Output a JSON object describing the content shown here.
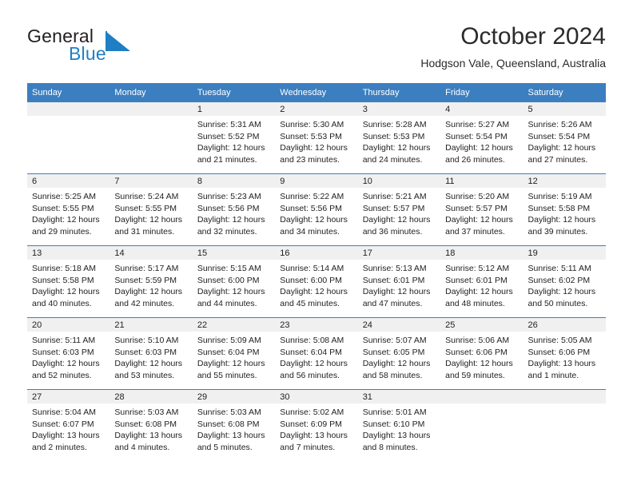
{
  "logo": {
    "word_one": "General",
    "word_two": "Blue",
    "flag_color": "#1f7fc4",
    "text_color": "#231f20"
  },
  "header": {
    "title": "October 2024",
    "subtitle": "Hodgson Vale, Queensland, Australia"
  },
  "theme": {
    "header_blue": "#3c7fc0",
    "day_band_gray": "#f0f0f0",
    "text": "#222222"
  },
  "weekday_headers": [
    "Sunday",
    "Monday",
    "Tuesday",
    "Wednesday",
    "Thursday",
    "Friday",
    "Saturday"
  ],
  "weeks": [
    [
      {
        "day": ""
      },
      {
        "day": ""
      },
      {
        "day": "1",
        "sunrise": "Sunrise: 5:31 AM",
        "sunset": "Sunset: 5:52 PM",
        "daylight_l1": "Daylight: 12 hours",
        "daylight_l2": "and 21 minutes."
      },
      {
        "day": "2",
        "sunrise": "Sunrise: 5:30 AM",
        "sunset": "Sunset: 5:53 PM",
        "daylight_l1": "Daylight: 12 hours",
        "daylight_l2": "and 23 minutes."
      },
      {
        "day": "3",
        "sunrise": "Sunrise: 5:28 AM",
        "sunset": "Sunset: 5:53 PM",
        "daylight_l1": "Daylight: 12 hours",
        "daylight_l2": "and 24 minutes."
      },
      {
        "day": "4",
        "sunrise": "Sunrise: 5:27 AM",
        "sunset": "Sunset: 5:54 PM",
        "daylight_l1": "Daylight: 12 hours",
        "daylight_l2": "and 26 minutes."
      },
      {
        "day": "5",
        "sunrise": "Sunrise: 5:26 AM",
        "sunset": "Sunset: 5:54 PM",
        "daylight_l1": "Daylight: 12 hours",
        "daylight_l2": "and 27 minutes."
      }
    ],
    [
      {
        "day": "6",
        "sunrise": "Sunrise: 5:25 AM",
        "sunset": "Sunset: 5:55 PM",
        "daylight_l1": "Daylight: 12 hours",
        "daylight_l2": "and 29 minutes."
      },
      {
        "day": "7",
        "sunrise": "Sunrise: 5:24 AM",
        "sunset": "Sunset: 5:55 PM",
        "daylight_l1": "Daylight: 12 hours",
        "daylight_l2": "and 31 minutes."
      },
      {
        "day": "8",
        "sunrise": "Sunrise: 5:23 AM",
        "sunset": "Sunset: 5:56 PM",
        "daylight_l1": "Daylight: 12 hours",
        "daylight_l2": "and 32 minutes."
      },
      {
        "day": "9",
        "sunrise": "Sunrise: 5:22 AM",
        "sunset": "Sunset: 5:56 PM",
        "daylight_l1": "Daylight: 12 hours",
        "daylight_l2": "and 34 minutes."
      },
      {
        "day": "10",
        "sunrise": "Sunrise: 5:21 AM",
        "sunset": "Sunset: 5:57 PM",
        "daylight_l1": "Daylight: 12 hours",
        "daylight_l2": "and 36 minutes."
      },
      {
        "day": "11",
        "sunrise": "Sunrise: 5:20 AM",
        "sunset": "Sunset: 5:57 PM",
        "daylight_l1": "Daylight: 12 hours",
        "daylight_l2": "and 37 minutes."
      },
      {
        "day": "12",
        "sunrise": "Sunrise: 5:19 AM",
        "sunset": "Sunset: 5:58 PM",
        "daylight_l1": "Daylight: 12 hours",
        "daylight_l2": "and 39 minutes."
      }
    ],
    [
      {
        "day": "13",
        "sunrise": "Sunrise: 5:18 AM",
        "sunset": "Sunset: 5:58 PM",
        "daylight_l1": "Daylight: 12 hours",
        "daylight_l2": "and 40 minutes."
      },
      {
        "day": "14",
        "sunrise": "Sunrise: 5:17 AM",
        "sunset": "Sunset: 5:59 PM",
        "daylight_l1": "Daylight: 12 hours",
        "daylight_l2": "and 42 minutes."
      },
      {
        "day": "15",
        "sunrise": "Sunrise: 5:15 AM",
        "sunset": "Sunset: 6:00 PM",
        "daylight_l1": "Daylight: 12 hours",
        "daylight_l2": "and 44 minutes."
      },
      {
        "day": "16",
        "sunrise": "Sunrise: 5:14 AM",
        "sunset": "Sunset: 6:00 PM",
        "daylight_l1": "Daylight: 12 hours",
        "daylight_l2": "and 45 minutes."
      },
      {
        "day": "17",
        "sunrise": "Sunrise: 5:13 AM",
        "sunset": "Sunset: 6:01 PM",
        "daylight_l1": "Daylight: 12 hours",
        "daylight_l2": "and 47 minutes."
      },
      {
        "day": "18",
        "sunrise": "Sunrise: 5:12 AM",
        "sunset": "Sunset: 6:01 PM",
        "daylight_l1": "Daylight: 12 hours",
        "daylight_l2": "and 48 minutes."
      },
      {
        "day": "19",
        "sunrise": "Sunrise: 5:11 AM",
        "sunset": "Sunset: 6:02 PM",
        "daylight_l1": "Daylight: 12 hours",
        "daylight_l2": "and 50 minutes."
      }
    ],
    [
      {
        "day": "20",
        "sunrise": "Sunrise: 5:11 AM",
        "sunset": "Sunset: 6:03 PM",
        "daylight_l1": "Daylight: 12 hours",
        "daylight_l2": "and 52 minutes."
      },
      {
        "day": "21",
        "sunrise": "Sunrise: 5:10 AM",
        "sunset": "Sunset: 6:03 PM",
        "daylight_l1": "Daylight: 12 hours",
        "daylight_l2": "and 53 minutes."
      },
      {
        "day": "22",
        "sunrise": "Sunrise: 5:09 AM",
        "sunset": "Sunset: 6:04 PM",
        "daylight_l1": "Daylight: 12 hours",
        "daylight_l2": "and 55 minutes."
      },
      {
        "day": "23",
        "sunrise": "Sunrise: 5:08 AM",
        "sunset": "Sunset: 6:04 PM",
        "daylight_l1": "Daylight: 12 hours",
        "daylight_l2": "and 56 minutes."
      },
      {
        "day": "24",
        "sunrise": "Sunrise: 5:07 AM",
        "sunset": "Sunset: 6:05 PM",
        "daylight_l1": "Daylight: 12 hours",
        "daylight_l2": "and 58 minutes."
      },
      {
        "day": "25",
        "sunrise": "Sunrise: 5:06 AM",
        "sunset": "Sunset: 6:06 PM",
        "daylight_l1": "Daylight: 12 hours",
        "daylight_l2": "and 59 minutes."
      },
      {
        "day": "26",
        "sunrise": "Sunrise: 5:05 AM",
        "sunset": "Sunset: 6:06 PM",
        "daylight_l1": "Daylight: 13 hours",
        "daylight_l2": "and 1 minute."
      }
    ],
    [
      {
        "day": "27",
        "sunrise": "Sunrise: 5:04 AM",
        "sunset": "Sunset: 6:07 PM",
        "daylight_l1": "Daylight: 13 hours",
        "daylight_l2": "and 2 minutes."
      },
      {
        "day": "28",
        "sunrise": "Sunrise: 5:03 AM",
        "sunset": "Sunset: 6:08 PM",
        "daylight_l1": "Daylight: 13 hours",
        "daylight_l2": "and 4 minutes."
      },
      {
        "day": "29",
        "sunrise": "Sunrise: 5:03 AM",
        "sunset": "Sunset: 6:08 PM",
        "daylight_l1": "Daylight: 13 hours",
        "daylight_l2": "and 5 minutes."
      },
      {
        "day": "30",
        "sunrise": "Sunrise: 5:02 AM",
        "sunset": "Sunset: 6:09 PM",
        "daylight_l1": "Daylight: 13 hours",
        "daylight_l2": "and 7 minutes."
      },
      {
        "day": "31",
        "sunrise": "Sunrise: 5:01 AM",
        "sunset": "Sunset: 6:10 PM",
        "daylight_l1": "Daylight: 13 hours",
        "daylight_l2": "and 8 minutes."
      },
      {
        "day": ""
      },
      {
        "day": ""
      }
    ]
  ]
}
